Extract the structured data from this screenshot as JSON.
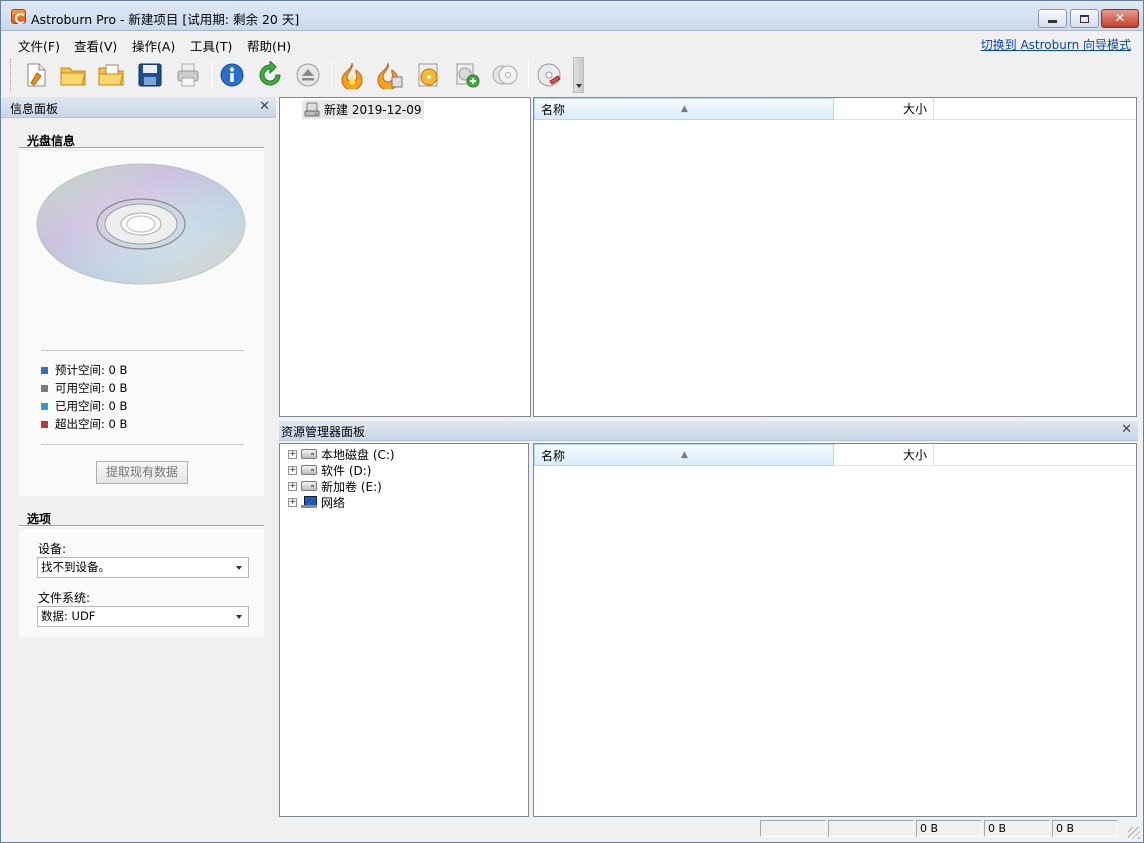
{
  "window": {
    "title": "Astroburn Pro - 新建项目  [试用期: 剩余 20 天]"
  },
  "menu": {
    "items": [
      "文件(F)",
      "查看(V)",
      "操作(A)",
      "工具(T)",
      "帮助(H)"
    ],
    "wizard_link": "切换到 Astroburn 向导模式"
  },
  "toolbar": {
    "buttons": [
      {
        "icon": "new-project-icon"
      },
      {
        "icon": "open-folder-icon"
      },
      {
        "icon": "open-project-icon"
      },
      {
        "icon": "save-icon"
      },
      {
        "icon": "print-icon"
      },
      {
        "icon": "info-icon"
      },
      {
        "icon": "refresh-icon"
      },
      {
        "icon": "eject-icon"
      },
      {
        "icon": "burn-icon"
      },
      {
        "icon": "burn-image-icon"
      },
      {
        "icon": "disc-image-icon"
      },
      {
        "icon": "add-disc-icon"
      },
      {
        "icon": "copy-disc-icon"
      },
      {
        "icon": "erase-disc-icon"
      }
    ]
  },
  "info_panel": {
    "title": "信息面板",
    "disc_section": "光盘信息",
    "legend": [
      {
        "label": "预计空间: 0 B",
        "color": "#2f6fc4"
      },
      {
        "label": "可用空间: 0 B",
        "color": "#7d7d7d"
      },
      {
        "label": "已用空间: 0 B",
        "color": "#2a9fd0"
      },
      {
        "label": "超出空间: 0 B",
        "color": "#c33333"
      }
    ],
    "read_button": "提取现有数据",
    "options_section": "选项",
    "device_label": "设备:",
    "device_value": "找不到设备。",
    "fs_label": "文件系统:",
    "fs_value": "数据: UDF"
  },
  "project": {
    "root": "新建 2019-12-09"
  },
  "list": {
    "col_name": "名称",
    "col_size": "大小"
  },
  "explorer": {
    "title": "资源管理器面板",
    "items": [
      {
        "label": "本地磁盘 (C:)",
        "icon": "drive-icon"
      },
      {
        "label": "软件 (D:)",
        "icon": "drive-icon"
      },
      {
        "label": "新加卷 (E:)",
        "icon": "drive-icon"
      },
      {
        "label": "网络",
        "icon": "network-icon"
      }
    ],
    "col_name": "名称",
    "col_size": "大小"
  },
  "status": {
    "cells": [
      "",
      "",
      "0 B",
      "0 B",
      "0 B"
    ]
  }
}
